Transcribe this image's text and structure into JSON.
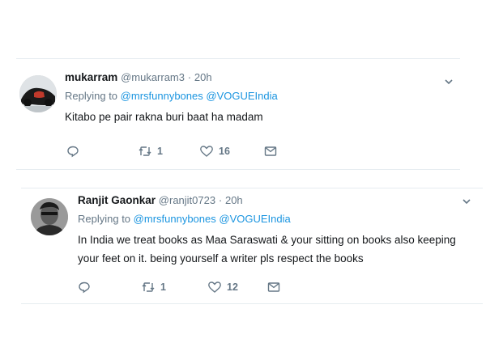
{
  "tweets": [
    {
      "name": "mukarram",
      "handle": "@mukarram3",
      "separator": "·",
      "time": "20h",
      "replying_label": "Replying to",
      "mentions": [
        "@mrsfunnybones",
        "@VOGUEIndia"
      ],
      "text": "Kitabo pe pair rakna buri baat ha madam",
      "retweets": "1",
      "likes": "16"
    },
    {
      "name": "Ranjit Gaonkar",
      "handle": "@ranjit0723",
      "separator": "·",
      "time": "20h",
      "replying_label": "Replying to",
      "mentions": [
        "@mrsfunnybones",
        "@VOGUEIndia"
      ],
      "text": "In India we treat books as Maa Saraswati & your sitting on books also keeping your feet on it. being yourself a writer pls respect the books",
      "retweets": "1",
      "likes": "12"
    }
  ],
  "icons": {
    "reply": "reply-icon",
    "retweet": "retweet-icon",
    "like": "heart-icon",
    "message": "envelope-icon",
    "more": "chevron-down-icon"
  },
  "colors": {
    "link": "#1b95e0",
    "secondary_text": "#657786",
    "primary_text": "#14171a",
    "divider": "#e6ecf0"
  }
}
